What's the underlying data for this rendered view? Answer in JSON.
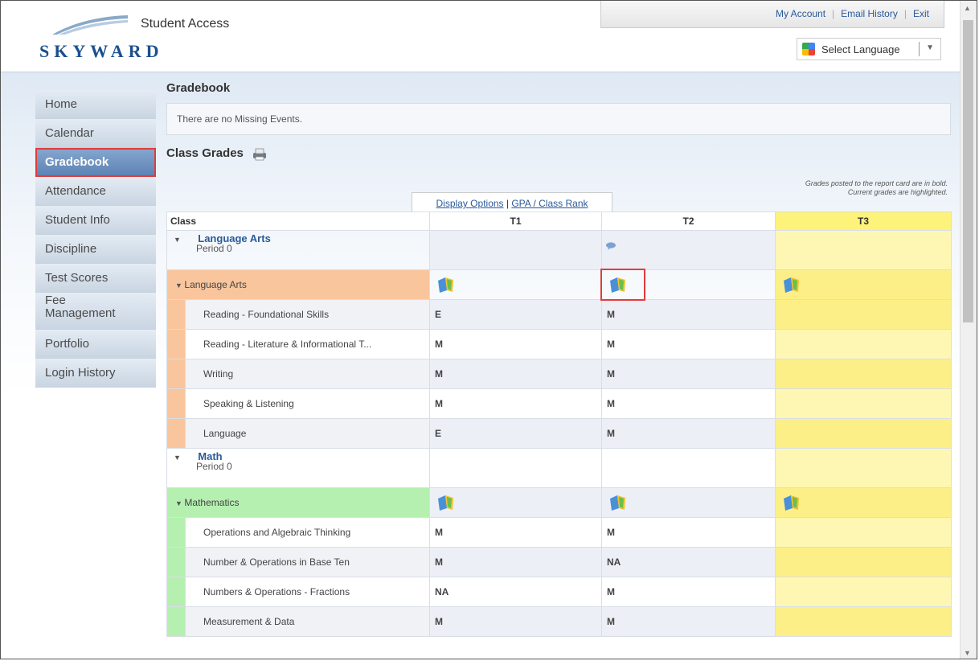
{
  "app": {
    "logo_text": "SKYWARD",
    "title": "Student Access"
  },
  "top_links": [
    "My Account",
    "Email History",
    "Exit"
  ],
  "language": {
    "label": "Select Language"
  },
  "sidebar": {
    "items": [
      {
        "label": "Home"
      },
      {
        "label": "Calendar"
      },
      {
        "label": "Gradebook",
        "active": true
      },
      {
        "label": "Attendance"
      },
      {
        "label": "Student Info"
      },
      {
        "label": "Discipline"
      },
      {
        "label": "Test Scores"
      },
      {
        "label": "Fee Management"
      },
      {
        "label": "Portfolio"
      },
      {
        "label": "Login History"
      }
    ]
  },
  "gradebook": {
    "title": "Gradebook",
    "missing_text": "There are no Missing Events.",
    "class_grades_title": "Class Grades",
    "note_line1": "Grades posted to the report card are in bold.",
    "note_line2": "Current grades are highlighted.",
    "display_options": "Display Options",
    "gpa_rank": "GPA / Class Rank",
    "columns": [
      "Class",
      "T1",
      "T2",
      "T3"
    ],
    "courses": [
      {
        "name": "Language Arts",
        "period": "Period 0",
        "subject": "Language Arts",
        "skills": [
          {
            "name": "Reading - Foundational Skills",
            "t1": "E",
            "t2": "M",
            "t3": ""
          },
          {
            "name": "Reading - Literature & Informational T...",
            "t1": "M",
            "t2": "M",
            "t3": ""
          },
          {
            "name": "Writing",
            "t1": "M",
            "t2": "M",
            "t3": ""
          },
          {
            "name": "Speaking & Listening",
            "t1": "M",
            "t2": "M",
            "t3": ""
          },
          {
            "name": "Language",
            "t1": "E",
            "t2": "M",
            "t3": ""
          }
        ]
      },
      {
        "name": "Math",
        "period": "Period 0",
        "subject": "Mathematics",
        "skills": [
          {
            "name": "Operations and Algebraic Thinking",
            "t1": "M",
            "t2": "M",
            "t3": ""
          },
          {
            "name": "Number & Operations in Base Ten",
            "t1": "M",
            "t2": "NA",
            "t3": ""
          },
          {
            "name": "Numbers & Operations - Fractions",
            "t1": "NA",
            "t2": "M",
            "t3": ""
          },
          {
            "name": "Measurement & Data",
            "t1": "M",
            "t2": "M",
            "t3": ""
          }
        ]
      }
    ]
  },
  "colors": {
    "nav_active": "#6b8fbe",
    "highlight_box": "#e03c3c",
    "t3_highlight": "#fcef88",
    "la_band": "#f9c59c",
    "math_band": "#b5f0b1"
  }
}
